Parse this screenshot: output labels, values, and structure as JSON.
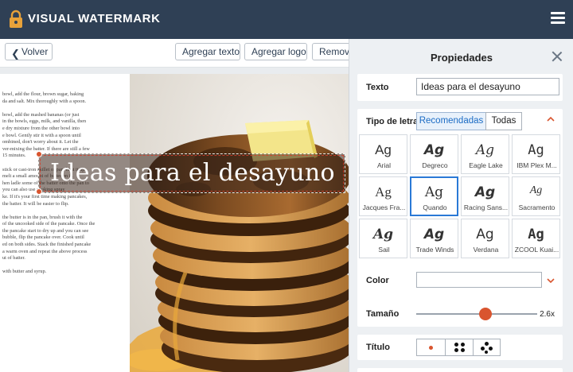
{
  "app": {
    "title": "VISUAL WATERMARK",
    "menu_icon": "hamburger-icon",
    "logo_icon": "lock-icon"
  },
  "toolbar": {
    "back_label": "Volver",
    "add_text_label": "Agregar texto",
    "add_logo_label": "Agregar logo",
    "remove_label": "Remove"
  },
  "canvas": {
    "watermark_text": "Ideas para el desayuno",
    "paper_lines": [
      "bowl, add the flour, brown sugar, baking",
      "da and salt. Mix thoroughly with a spoon.",
      "",
      "bowl, add the mashed bananas (or just",
      "in the bowls, eggs, milk, and vanilla, then",
      "e dry mixture from the other bowl into",
      "e bowl. Gently stir it with a spoon until",
      "ombined, don't worry about it. Let the",
      "ver-mixing the batter. If there are still a few",
      "15 minutes.",
      "",
      "stick or cast-iron skillet or pan, heat it up",
      "melt a small amount of butter on it.",
      "hen ladle some of the batter onto the pan to",
      "you can also use cooking spray",
      "ke. If it's your first time making pancakes,",
      "the batter. It will be easier to flip.",
      "",
      "the butter is in the pan, brush it with the",
      "of the uncooked side of the pancake. Once the",
      "the pancake start to dry up and you can see",
      "bubble, flip the pancake over. Cook until",
      "ed on both sides. Stack the finished pancake",
      "a warm oven and repeat the above process",
      "ut of batter.",
      "",
      "with butter and syrup."
    ]
  },
  "panel": {
    "title": "Propiedades",
    "close_icon": "close-icon",
    "text_label": "Texto",
    "text_value": "Ideas para el desayuno",
    "font_label": "Tipo de letra",
    "font_tabs": {
      "recommended": "Recomendadas",
      "all": "Todas"
    },
    "fonts": [
      {
        "sample": "Ag",
        "name": "Arial"
      },
      {
        "sample": "Ag",
        "name": "Degreco"
      },
      {
        "sample": "Ag",
        "name": "Eagle Lake"
      },
      {
        "sample": "Ag",
        "name": "IBM Plex M..."
      },
      {
        "sample": "Ag",
        "name": "Jacques Fra..."
      },
      {
        "sample": "Ag",
        "name": "Quando"
      },
      {
        "sample": "Ag",
        "name": "Racing Sans..."
      },
      {
        "sample": "Ag",
        "name": "Sacramento"
      },
      {
        "sample": "Ag",
        "name": "Sail"
      },
      {
        "sample": "Ag",
        "name": "Trade Winds"
      },
      {
        "sample": "Ag",
        "name": "Verdana"
      },
      {
        "sample": "Ag",
        "name": "ZCOOL Kuai..."
      }
    ],
    "selected_font": "Quando",
    "color_label": "Color",
    "color_value": "#ffffff",
    "size_label": "Tamaño",
    "size_value": "2.6x",
    "size_fraction": 0.57,
    "title_label": "Título",
    "title_options": [
      "single-dot-icon",
      "four-dots-icon",
      "five-dots-icon"
    ],
    "accent_color": "#d9552f",
    "selection_color": "#2a79d6"
  }
}
